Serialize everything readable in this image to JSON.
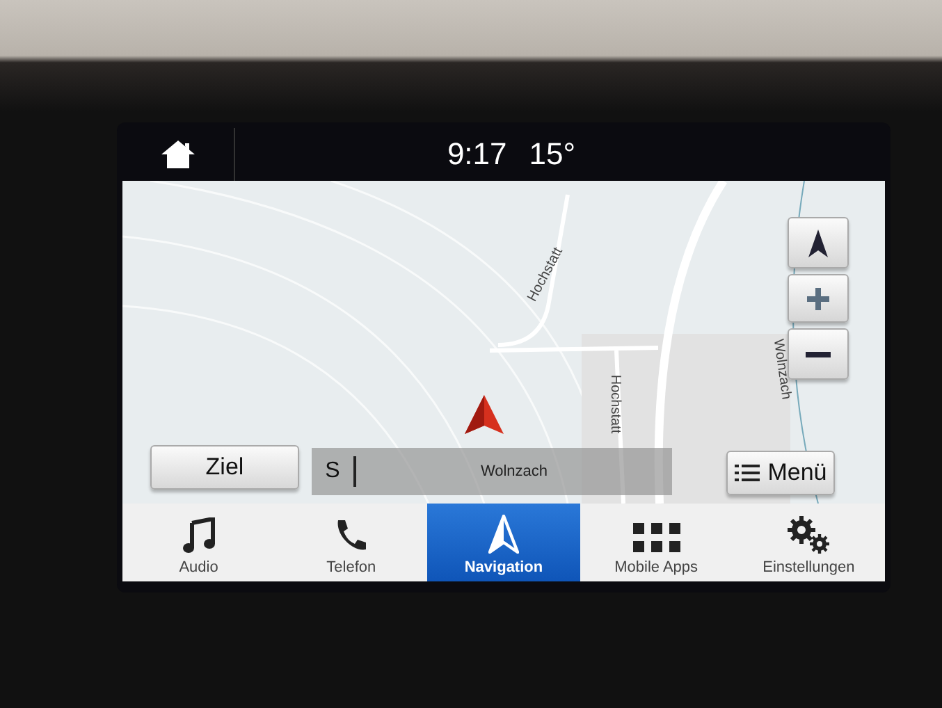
{
  "status_bar": {
    "time": "9:17",
    "temperature": "15°"
  },
  "map": {
    "street_labels": [
      {
        "text": "Hochstatt",
        "kind": "diagonal"
      },
      {
        "text": "Hochstatt",
        "kind": "vertical"
      },
      {
        "text": "Wolnzach",
        "kind": "river"
      }
    ],
    "destination_button": "Ziel",
    "search": {
      "prefix": "S",
      "value": "Wolnzach"
    },
    "menu_button": "Menü"
  },
  "tabs": [
    {
      "label": "Audio",
      "kind": "audio",
      "selected": false
    },
    {
      "label": "Telefon",
      "kind": "phone",
      "selected": false
    },
    {
      "label": "Navigation",
      "kind": "navigation",
      "selected": true
    },
    {
      "label": "Mobile Apps",
      "kind": "apps",
      "selected": false
    },
    {
      "label": "Einstellungen",
      "kind": "settings",
      "selected": false
    }
  ]
}
